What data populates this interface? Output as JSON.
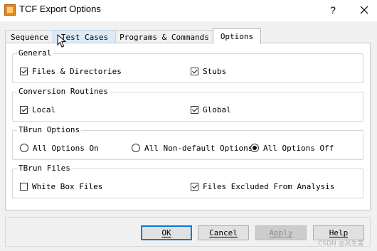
{
  "window": {
    "title": "TCF Export Options",
    "help": "?",
    "close": "close"
  },
  "tabs": [
    {
      "label": "Sequence",
      "state": "normal"
    },
    {
      "label": "Test Cases",
      "state": "hover"
    },
    {
      "label": "Programs & Commands",
      "state": "normal"
    },
    {
      "label": "Options",
      "state": "active"
    }
  ],
  "groups": {
    "general": {
      "title": "General",
      "options": [
        {
          "label": "Files & Directories",
          "checked": true
        },
        {
          "label": "Stubs",
          "checked": true
        }
      ]
    },
    "conversion": {
      "title": "Conversion Routines",
      "options": [
        {
          "label": "Local",
          "checked": true
        },
        {
          "label": "Global",
          "checked": true
        }
      ]
    },
    "tbrun": {
      "title": "TBrun Options",
      "options": [
        {
          "label": "All Options On",
          "selected": false
        },
        {
          "label": "All Non-default Options",
          "selected": false
        },
        {
          "label": "All Options Off",
          "selected": true
        }
      ]
    },
    "files": {
      "title": "TBrun Files",
      "options": [
        {
          "label": "White Box Files",
          "checked": false
        },
        {
          "label": "Files Excluded From Analysis",
          "checked": true
        }
      ]
    }
  },
  "buttons": {
    "ok": "OK",
    "cancel": "Cancel",
    "apply": "Apply",
    "help": "Help"
  },
  "watermark": "CSDN @风生害"
}
